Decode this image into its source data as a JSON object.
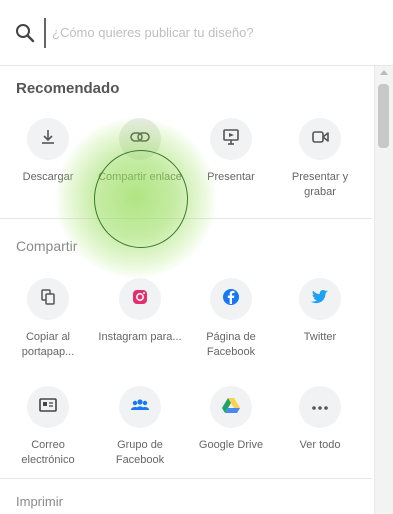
{
  "search": {
    "placeholder": "¿Cómo quieres publicar tu diseño?"
  },
  "sections": {
    "recommended": "Recomendado",
    "share": "Compartir",
    "print": "Imprimir"
  },
  "recommended_items": [
    {
      "label": "Descargar",
      "icon": "download-icon"
    },
    {
      "label": "Compartir enlace",
      "icon": "link-icon"
    },
    {
      "label": "Presentar",
      "icon": "present-icon"
    },
    {
      "label": "Presentar y grabar",
      "icon": "present-record-icon"
    }
  ],
  "share_items": [
    {
      "label": "Copiar al portapap...",
      "icon": "copy-icon"
    },
    {
      "label": "Instagram para...",
      "icon": "instagram-icon"
    },
    {
      "label": "Página de Facebook",
      "icon": "facebook-icon"
    },
    {
      "label": "Twitter",
      "icon": "twitter-icon"
    },
    {
      "label": "Correo electrónico",
      "icon": "email-icon"
    },
    {
      "label": "Grupo de Facebook",
      "icon": "facebook-group-icon"
    },
    {
      "label": "Google Drive",
      "icon": "google-drive-icon"
    },
    {
      "label": "Ver todo",
      "icon": "more-icon"
    }
  ],
  "colors": {
    "accent_highlight": "#96dc5a",
    "instagram": "#e1306c",
    "facebook": "#1877f2",
    "twitter": "#1da1f2",
    "drive_green": "#1fa463",
    "drive_yellow": "#ffd04b",
    "drive_blue": "#4688f4"
  }
}
